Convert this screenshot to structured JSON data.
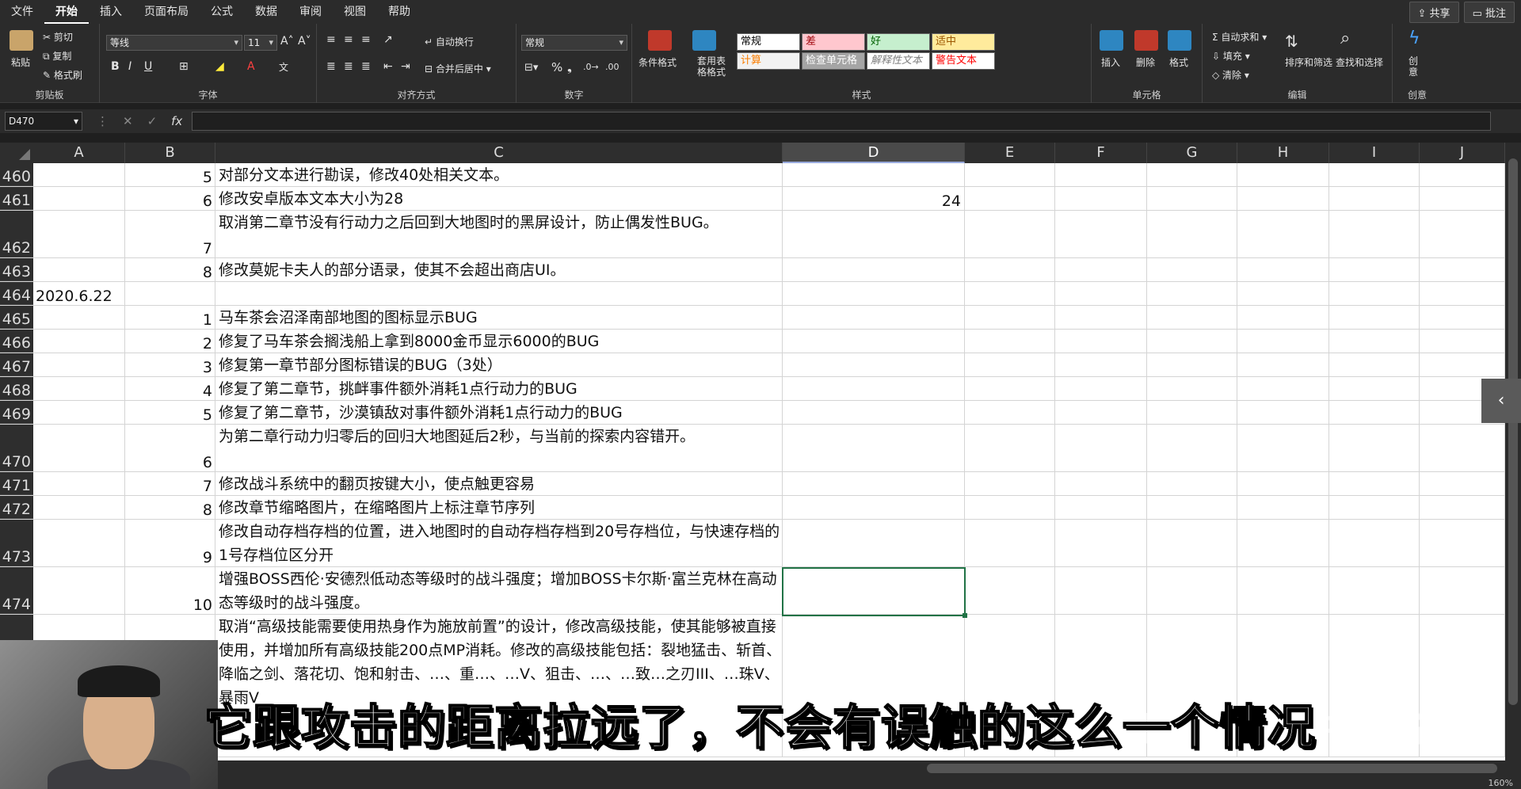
{
  "menu": {
    "tabs": [
      "文件",
      "开始",
      "插入",
      "页面布局",
      "公式",
      "数据",
      "审阅",
      "视图",
      "帮助"
    ],
    "active": "开始",
    "share": "共享",
    "comments": "批注"
  },
  "ribbon": {
    "clipboard": {
      "paste": "粘贴",
      "cut": "剪切",
      "copy": "复制",
      "format_painter": "格式刷",
      "label": "剪贴板"
    },
    "font": {
      "name": "等线",
      "size": "11",
      "label": "字体"
    },
    "align": {
      "wrap": "自动换行",
      "merge": "合并后居中",
      "label": "对齐方式"
    },
    "number": {
      "format": "常规",
      "label": "数字"
    },
    "styles": {
      "conditional": "条件格式",
      "table_format": "套用表格格式",
      "cells": [
        {
          "text": "常规",
          "bg": "#ffffff",
          "fg": "#000000"
        },
        {
          "text": "差",
          "bg": "#ffc7ce",
          "fg": "#9c0006"
        },
        {
          "text": "好",
          "bg": "#c6efce",
          "fg": "#006100"
        },
        {
          "text": "适中",
          "bg": "#ffeb9c",
          "fg": "#9c5700"
        },
        {
          "text": "计算",
          "bg": "#f2f2f2",
          "fg": "#fa7d00"
        },
        {
          "text": "检查单元格",
          "bg": "#a5a5a5",
          "fg": "#ffffff"
        },
        {
          "text": "解释性文本",
          "bg": "#ffffff",
          "fg": "#7f7f7f"
        },
        {
          "text": "警告文本",
          "bg": "#ffffff",
          "fg": "#ff0000"
        }
      ],
      "label": "样式"
    },
    "cells_group": {
      "insert": "插入",
      "delete": "删除",
      "format": "格式",
      "label": "单元格"
    },
    "editing": {
      "autosum": "自动求和",
      "fill": "填充",
      "clear": "清除",
      "sort": "排序和筛选",
      "find": "查找和选择",
      "label": "编辑"
    },
    "creative": {
      "btn": "创意",
      "label": "创意"
    }
  },
  "formula_bar": {
    "name_box": "D470",
    "fx": "fx"
  },
  "columns": [
    "A",
    "B",
    "C",
    "D",
    "E",
    "F",
    "G",
    "H",
    "I",
    "J"
  ],
  "selected_column": "D",
  "rows": [
    {
      "num": "460",
      "a": "",
      "b": "5",
      "c": "对部分文本进行勘误，修改40处相关文本。",
      "d": ""
    },
    {
      "num": "461",
      "a": "",
      "b": "6",
      "c": "修改安卓版本文本大小为28",
      "d": "24"
    },
    {
      "num": "462",
      "a": "",
      "b": "7",
      "c": "取消第二章节没有行动力之后回到大地图时的黑屏设计，防止偶发性BUG。",
      "d": ""
    },
    {
      "num": "463",
      "a": "",
      "b": "8",
      "c": "修改莫妮卡夫人的部分语录，使其不会超出商店UI。",
      "d": ""
    },
    {
      "num": "464",
      "a": "2020.6.22",
      "b": "",
      "c": "",
      "d": ""
    },
    {
      "num": "465",
      "a": "",
      "b": "1",
      "c": "马车茶会沼泽南部地图的图标显示BUG",
      "d": ""
    },
    {
      "num": "466",
      "a": "",
      "b": "2",
      "c": "修复了马车茶会搁浅船上拿到8000金币显示6000的BUG",
      "d": ""
    },
    {
      "num": "467",
      "a": "",
      "b": "3",
      "c": "修复第一章节部分图标错误的BUG（3处）",
      "d": ""
    },
    {
      "num": "468",
      "a": "",
      "b": "4",
      "c": "修复了第二章节，挑衅事件额外消耗1点行动力的BUG",
      "d": ""
    },
    {
      "num": "469",
      "a": "",
      "b": "5",
      "c": "修复了第二章节，沙漠镇敌对事件额外消耗1点行动力的BUG",
      "d": ""
    },
    {
      "num": "470",
      "a": "",
      "b": "6",
      "c": "为第二章行动力归零后的回归大地图延后2秒，与当前的探索内容错开。",
      "d": ""
    },
    {
      "num": "471",
      "a": "",
      "b": "7",
      "c": "修改战斗系统中的翻页按键大小，使点触更容易",
      "d": ""
    },
    {
      "num": "472",
      "a": "",
      "b": "8",
      "c": "修改章节缩略图片，在缩略图片上标注章节序列",
      "d": ""
    },
    {
      "num": "473",
      "a": "",
      "b": "9",
      "c": "修改自动存档存档的位置，进入地图时的自动存档存档到20号存档位，与快速存档的1号存档位区分开",
      "d": ""
    },
    {
      "num": "474",
      "a": "",
      "b": "10",
      "c": "增强BOSS西伦·安德烈低动态等级时的战斗强度；增加BOSS卡尔斯·富兰克林在高动态等级时的战斗强度。",
      "d": ""
    },
    {
      "num": "",
      "a": "",
      "b": "",
      "c": "取消“高级技能需要使用热身作为施放前置”的设计，修改高级技能，使其能够被直接使用，并增加所有高级技能200点MP消耗。修改的高级技能包括：裂地猛击、斩首、降临之剑、落花切、饱和射击、…、重…、…V、狙击、…、…致…之刃III、…珠V、暴雨V",
      "d": ""
    }
  ],
  "subtitle": "它跟攻击的距离拉远了，不会有误触的这么一个情况",
  "watermark": "知乎 @游戏神不说话",
  "status": "160%"
}
